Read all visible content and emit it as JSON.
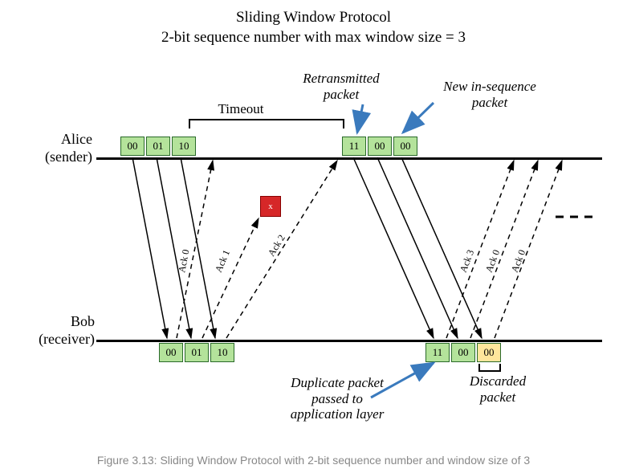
{
  "title_line1": "Sliding Window Protocol",
  "title_line2": "2-bit sequence number with max window size = 3",
  "labels": {
    "timeout": "Timeout",
    "retransmitted": "Retransmitted\npacket",
    "new_in_seq": "New in-sequence\npacket",
    "duplicate": "Duplicate packet\npassed to\napplication layer",
    "discarded": "Discarded\npacket"
  },
  "roles": {
    "alice": "Alice\n(sender)",
    "bob": "Bob\n(receiver)"
  },
  "alice_window1": [
    "00",
    "01",
    "10"
  ],
  "alice_window2": [
    "11",
    "00",
    "00"
  ],
  "bob_window1": [
    "00",
    "01",
    "10"
  ],
  "bob_window2": [
    "11",
    "00",
    "00"
  ],
  "acks": {
    "a0": "Ack 0",
    "a1": "Ack 1",
    "a2": "Ack 2",
    "a3": "Ack 3",
    "a0b": "Ack 0",
    "a0c": "Ack 0"
  },
  "x": "x",
  "caption": "Figure 3.13: Sliding Window Protocol with 2-bit sequence number and window size of 3"
}
